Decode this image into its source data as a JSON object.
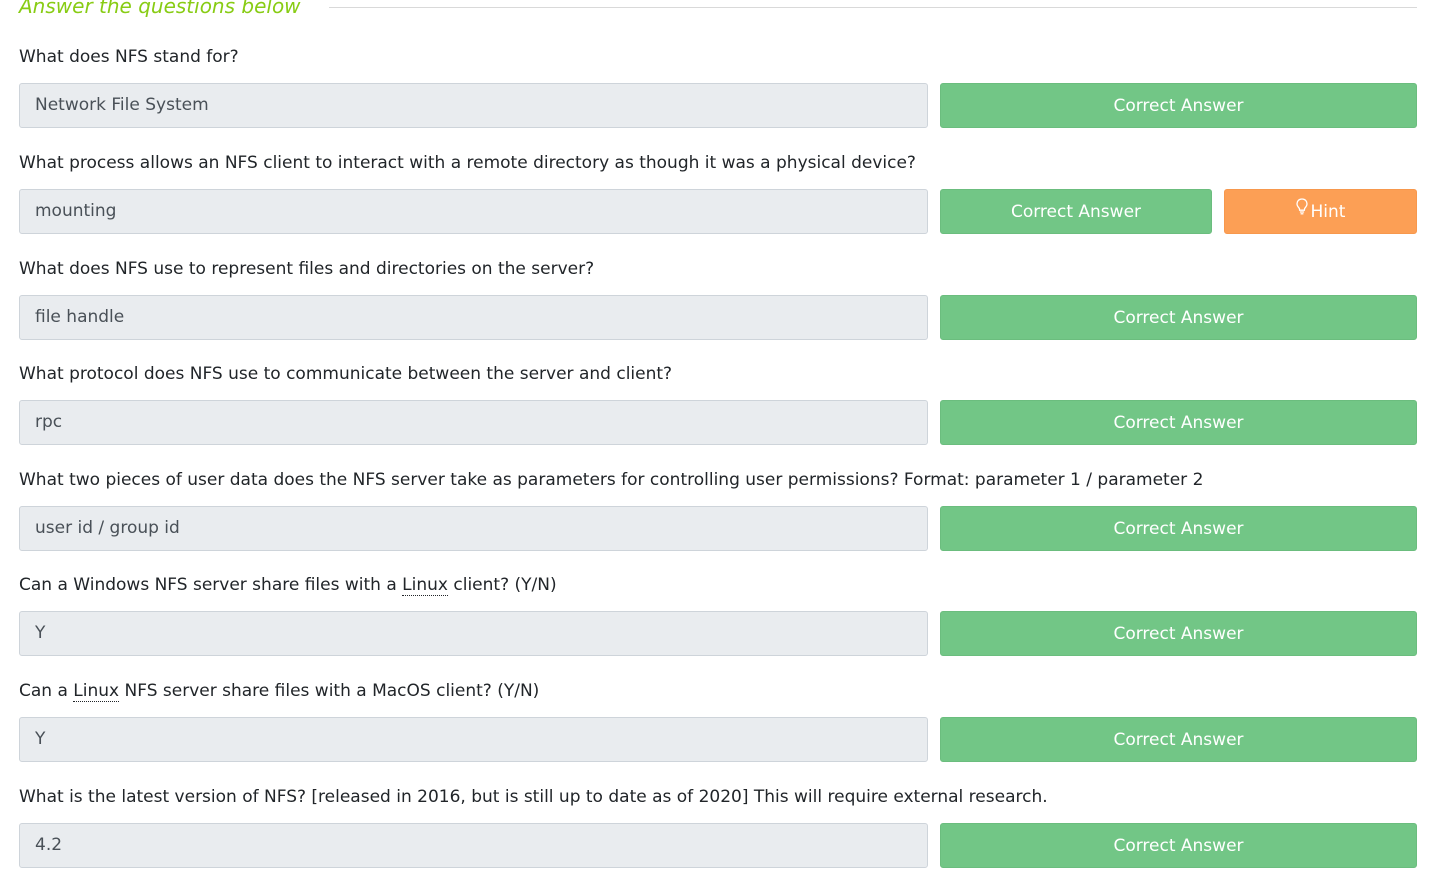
{
  "section": {
    "title": "Answer the questions below"
  },
  "questions": [
    {
      "text": "What does NFS stand for?",
      "answer": "Network File System",
      "button": "Correct Answer"
    },
    {
      "text": "What process allows an NFS client to interact with a remote directory as though it was a physical device?",
      "answer": "mounting",
      "button": "Correct Answer",
      "hint": "Hint"
    },
    {
      "text": "What does NFS use to represent files and directories on the server?",
      "answer": "file handle",
      "button": "Correct Answer"
    },
    {
      "text": "What protocol does NFS use to communicate between the server and client?",
      "answer": "rpc",
      "button": "Correct Answer"
    },
    {
      "text": "What two pieces of user data does the NFS server take as parameters for controlling user permissions? Format: parameter 1 / parameter 2",
      "answer": "user id / group id",
      "button": "Correct Answer"
    },
    {
      "text_before": "Can a Windows NFS server share files with a ",
      "text_link": "Linux",
      "text_after": " client? (Y/N)",
      "answer": "Y",
      "button": "Correct Answer"
    },
    {
      "text_before": "Can a ",
      "text_link": "Linux",
      "text_after": " NFS server share files with a MacOS client? (Y/N)",
      "answer": "Y",
      "button": "Correct Answer"
    },
    {
      "text": "What is the latest version of NFS? [released in 2016, but is still up to date as of 2020] This will require external research.",
      "answer": "4.2",
      "button": "Correct Answer"
    }
  ],
  "colors": {
    "accent": "#88cc14",
    "correct": "#72c686",
    "hint": "#fc9f55",
    "field_bg": "#e9ecef"
  },
  "icons": {
    "hint": "lightbulb-icon"
  }
}
